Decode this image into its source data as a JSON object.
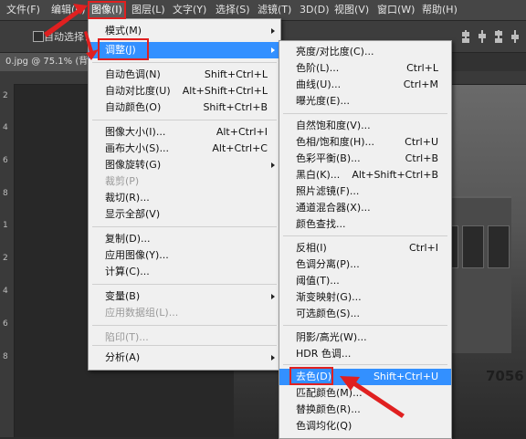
{
  "menubar": {
    "items": [
      "文件(F)",
      "编辑(E)",
      "图像(I)",
      "图层(L)",
      "文字(Y)",
      "选择(S)",
      "滤镜(T)",
      "3D(D)",
      "视图(V)",
      "窗口(W)",
      "帮助(H)"
    ]
  },
  "options": {
    "auto_select": "自动选择："
  },
  "tab": {
    "title": "0.jpg @ 75.1% (背"
  },
  "ruler": {
    "left_numbers": [
      "2",
      "4",
      "6",
      "8",
      "1",
      "2",
      "4",
      "6",
      "8"
    ]
  },
  "photo": {
    "train_number": "7056"
  },
  "image_menu": {
    "items": [
      {
        "label": "模式(M)",
        "shortcut": "",
        "submenu": true,
        "disabled": false
      },
      {
        "label": "调整(J)",
        "shortcut": "",
        "submenu": true,
        "disabled": false,
        "highlighted": true
      },
      {
        "label": "自动色调(N)",
        "shortcut": "Shift+Ctrl+L"
      },
      {
        "label": "自动对比度(U)",
        "shortcut": "Alt+Shift+Ctrl+L"
      },
      {
        "label": "自动颜色(O)",
        "shortcut": "Shift+Ctrl+B"
      },
      {
        "label": "图像大小(I)...",
        "shortcut": "Alt+Ctrl+I"
      },
      {
        "label": "画布大小(S)...",
        "shortcut": "Alt+Ctrl+C"
      },
      {
        "label": "图像旋转(G)",
        "shortcut": "",
        "submenu": true
      },
      {
        "label": "裁剪(P)",
        "shortcut": "",
        "disabled": true
      },
      {
        "label": "裁切(R)...",
        "shortcut": ""
      },
      {
        "label": "显示全部(V)",
        "shortcut": ""
      },
      {
        "label": "复制(D)...",
        "shortcut": ""
      },
      {
        "label": "应用图像(Y)...",
        "shortcut": ""
      },
      {
        "label": "计算(C)...",
        "shortcut": ""
      },
      {
        "label": "变量(B)",
        "shortcut": "",
        "submenu": true
      },
      {
        "label": "应用数据组(L)...",
        "shortcut": "",
        "disabled": true
      },
      {
        "label": "陷印(T)...",
        "shortcut": "",
        "disabled": true
      },
      {
        "label": "分析(A)",
        "shortcut": "",
        "submenu": true
      }
    ]
  },
  "adjust_menu": {
    "items": [
      {
        "label": "亮度/对比度(C)...",
        "shortcut": ""
      },
      {
        "label": "色阶(L)...",
        "shortcut": "Ctrl+L"
      },
      {
        "label": "曲线(U)...",
        "shortcut": "Ctrl+M"
      },
      {
        "label": "曝光度(E)...",
        "shortcut": ""
      },
      {
        "label": "自然饱和度(V)...",
        "shortcut": ""
      },
      {
        "label": "色相/饱和度(H)...",
        "shortcut": "Ctrl+U"
      },
      {
        "label": "色彩平衡(B)...",
        "shortcut": "Ctrl+B"
      },
      {
        "label": "黑白(K)...",
        "shortcut": "Alt+Shift+Ctrl+B"
      },
      {
        "label": "照片滤镜(F)...",
        "shortcut": ""
      },
      {
        "label": "通道混合器(X)...",
        "shortcut": ""
      },
      {
        "label": "颜色查找...",
        "shortcut": ""
      },
      {
        "label": "反相(I)",
        "shortcut": "Ctrl+I"
      },
      {
        "label": "色调分离(P)...",
        "shortcut": ""
      },
      {
        "label": "阈值(T)...",
        "shortcut": ""
      },
      {
        "label": "渐变映射(G)...",
        "shortcut": ""
      },
      {
        "label": "可选颜色(S)...",
        "shortcut": ""
      },
      {
        "label": "阴影/高光(W)...",
        "shortcut": ""
      },
      {
        "label": "HDR 色调...",
        "shortcut": ""
      },
      {
        "label": "去色(D)",
        "shortcut": "Shift+Ctrl+U",
        "highlighted": true
      },
      {
        "label": "匹配颜色(M)...",
        "shortcut": ""
      },
      {
        "label": "替换颜色(R)...",
        "shortcut": ""
      },
      {
        "label": "色调均化(Q)",
        "shortcut": ""
      }
    ]
  },
  "colors": {
    "highlight": "#3390ff",
    "annotation_red": "#e02020",
    "menu_bg": "#f0f0f0"
  }
}
